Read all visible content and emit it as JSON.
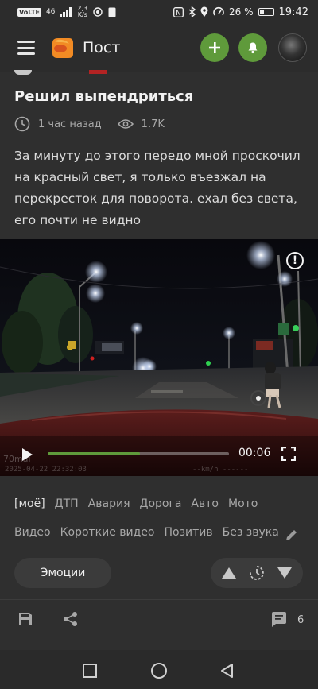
{
  "status_bar": {
    "network_chip": "VoLTE",
    "signal": "46",
    "speed_value": "2,3",
    "speed_unit": "K/s",
    "battery_percent": "26 %",
    "time": "19:42"
  },
  "header": {
    "title": "Пост",
    "icons": [
      "menu-icon",
      "logo-icon",
      "add-icon",
      "bell-icon",
      "avatar"
    ]
  },
  "post": {
    "title": "Решил выпендриться",
    "time_ago": "1 час назад",
    "views": "1.7K",
    "text": "За минуту до этого передо мной проскочил на красный свет, я только въезжал на перекресток для поворота. ехал без света, его почти не видно"
  },
  "video": {
    "current_time": "00:06",
    "progress": 0.51,
    "watermark": "70mai",
    "timestamp": "2025-04-22 22:32:03",
    "speed_stamp": "--km/h ------"
  },
  "tags": {
    "row1": [
      "[моё]",
      "ДТП",
      "Авария",
      "Дорога",
      "Авто",
      "Мото"
    ],
    "row2": [
      "Видео",
      "Короткие видео",
      "Позитив",
      "Без звука"
    ]
  },
  "actions": {
    "emotions_label": "Эмоции",
    "comments_count": "6"
  },
  "colors": {
    "accent": "#5f9a3b",
    "background": "#2f2f2f",
    "chip": "#3b3b3b"
  }
}
